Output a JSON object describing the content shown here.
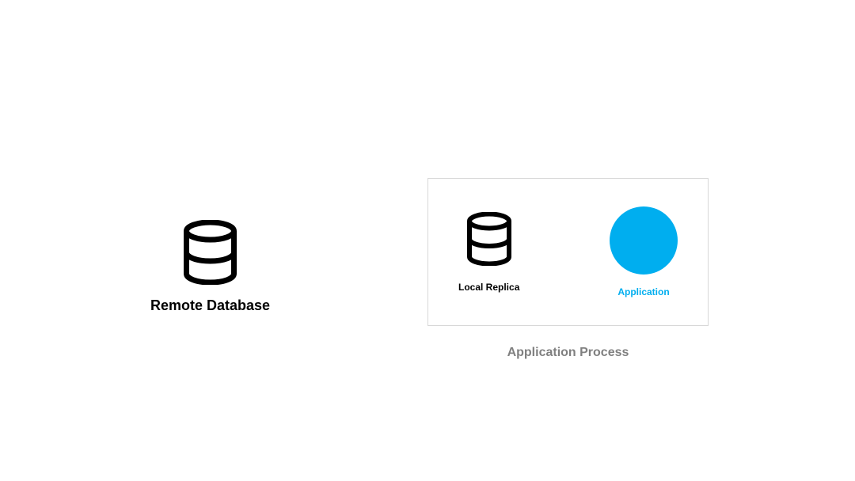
{
  "remote_db": {
    "label": "Remote Database"
  },
  "app_process": {
    "label": "Application Process",
    "local_replica": {
      "label": "Local Replica"
    },
    "application": {
      "label": "Application",
      "color": "#00aeef"
    }
  }
}
